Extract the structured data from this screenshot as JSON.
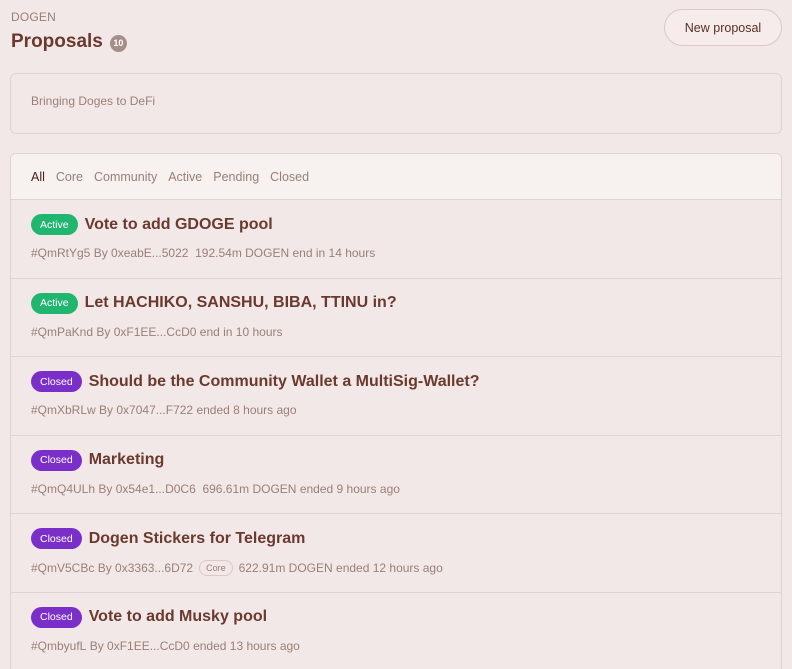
{
  "header": {
    "space_name": "DOGEN",
    "title": "Proposals",
    "count": "10",
    "new_proposal_label": "New proposal"
  },
  "about": {
    "text": "Bringing Doges to DeFi"
  },
  "tabs": [
    {
      "label": "All",
      "active": true
    },
    {
      "label": "Core",
      "active": false
    },
    {
      "label": "Community",
      "active": false
    },
    {
      "label": "Active",
      "active": false
    },
    {
      "label": "Pending",
      "active": false
    },
    {
      "label": "Closed",
      "active": false
    }
  ],
  "proposals": [
    {
      "state": "Active",
      "title": "Vote to add GDOGE pool",
      "id": "#QmRtYg5",
      "by": "By 0xeabE...5022",
      "tag": "",
      "power": "192.54m DOGEN",
      "time": "end in 14 hours"
    },
    {
      "state": "Active",
      "title": "Let HACHIKO, SANSHU, BIBA, TTINU in?",
      "id": "#QmPaKnd",
      "by": "By 0xF1EE...CcD0",
      "tag": "",
      "power": "",
      "time": "end in 10 hours"
    },
    {
      "state": "Closed",
      "title": "Should be the Community Wallet a MultiSig-Wallet?",
      "id": "#QmXbRLw",
      "by": "By 0x7047...F722",
      "tag": "",
      "power": "",
      "time": "ended 8 hours ago"
    },
    {
      "state": "Closed",
      "title": "Marketing",
      "id": "#QmQ4ULh",
      "by": "By 0x54e1...D0C6",
      "tag": "",
      "power": "696.61m DOGEN",
      "time": "ended 9 hours ago"
    },
    {
      "state": "Closed",
      "title": "Dogen Stickers for Telegram",
      "id": "#QmV5CBc",
      "by": "By 0x3363...6D72",
      "tag": "Core",
      "power": "622.91m DOGEN",
      "time": "ended 12 hours ago"
    },
    {
      "state": "Closed",
      "title": "Vote to add Musky pool",
      "id": "#QmbyufL",
      "by": "By 0xF1EE...CcD0",
      "tag": "",
      "power": "",
      "time": "ended 13 hours ago"
    }
  ],
  "colors": {
    "background": "#f2e8e7",
    "title": "#6b3a2e",
    "muted": "#9a7f78",
    "active_state": "#21b66f",
    "closed_state": "#7b2fc9"
  }
}
